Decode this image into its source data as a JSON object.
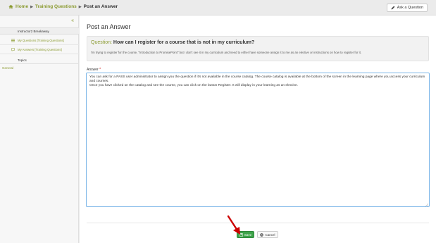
{
  "breadcrumb": {
    "home": "Home",
    "section": "Training Questions",
    "current": "Post an Answer"
  },
  "toolbar": {
    "ask_label": "Ask a Question"
  },
  "sidebar": {
    "collapse": "«",
    "heading": "Instructor2 Breakaway",
    "items": [
      {
        "label": "My Questions [Training Questions]",
        "icon": "list-icon"
      },
      {
        "label": "My Answers [Training Questions]",
        "icon": "comment-icon"
      }
    ],
    "topics_label": "Topics",
    "general_label": "General"
  },
  "main": {
    "title": "Post an Answer",
    "question": {
      "prefix": "Question:",
      "text": "How can I register for a course that is not in my curriculum?",
      "body": "I'm trying to register for the course, \"Introduction to PromisePoint\" but I don't see it in my curriculum and need to either have someone assign it to me as an elective or instructions on how to register for it."
    },
    "answer": {
      "label": "Answer",
      "required_mark": "*",
      "value": "You can ask for a PASS user administrator to assign you the question if it's not available in the course catalog. The course catalog is available at the bottom of the screen in the learning page where you access your curriculum and courses.\nOnce you have clicked on the catalog and see the course, you can click on the button Register. It will display in your learning as an elective."
    },
    "save_label": "Save",
    "cancel_label": "Cancel"
  },
  "colors": {
    "accent": "#8a9a2f",
    "save": "#3ea34a",
    "focus_border": "#7cb6e8",
    "annotation_arrow": "#cc0000"
  }
}
